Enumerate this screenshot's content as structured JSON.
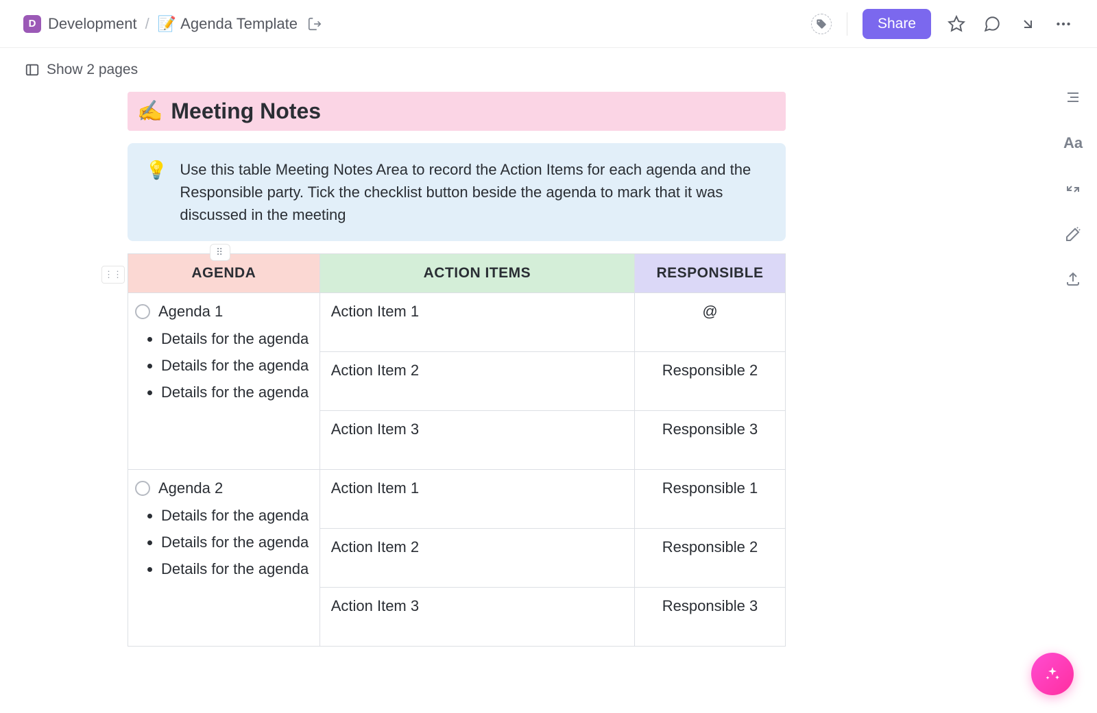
{
  "breadcrumb": {
    "workspace_initial": "D",
    "workspace": "Development",
    "page_emoji": "📝",
    "page": "Agenda Template"
  },
  "header": {
    "share_label": "Share"
  },
  "show_pages_label": "Show 2 pages",
  "doc": {
    "title_emoji": "✍️",
    "title": "Meeting Notes",
    "callout_emoji": "💡",
    "callout_text": "Use this table Meeting Notes Area to record the Action Items for each agenda and the Responsible party. Tick the checklist button beside the agenda to mark that it was discussed in the meeting"
  },
  "table": {
    "headers": {
      "agenda": "AGENDA",
      "action": "ACTION ITEMS",
      "responsible": "RESPONSIBLE"
    },
    "rows": [
      {
        "agenda_title": "Agenda 1",
        "details": [
          "Details for the agenda",
          "Details for the agenda",
          "Details for the agenda"
        ],
        "actions": [
          {
            "action": "Action Item 1",
            "responsible": "@"
          },
          {
            "action": "Action Item 2",
            "responsible": "Responsible 2"
          },
          {
            "action": "Action Item 3",
            "responsible": "Responsible 3"
          }
        ]
      },
      {
        "agenda_title": "Agenda 2",
        "details": [
          "Details for the agenda",
          "Details for the agenda",
          "Details for the agenda"
        ],
        "actions": [
          {
            "action": "Action Item 1",
            "responsible": "Responsible 1"
          },
          {
            "action": "Action Item 2",
            "responsible": "Responsible 2"
          },
          {
            "action": "Action Item 3",
            "responsible": "Responsible 3"
          }
        ]
      }
    ]
  }
}
